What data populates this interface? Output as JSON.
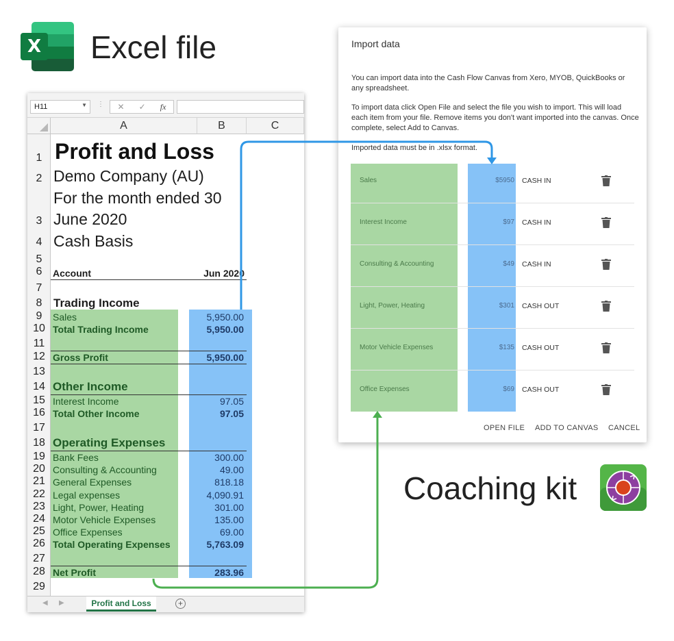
{
  "header": {
    "excel_logo_letter": "X",
    "title": "Excel file"
  },
  "excel": {
    "namebox": "H11",
    "formula_icons": [
      "✕",
      "✓",
      "fx"
    ],
    "columns": [
      "A",
      "B",
      "C"
    ],
    "rows": [
      {
        "n": "1"
      },
      {
        "n": "2"
      },
      {
        "n": "3"
      },
      {
        "n": "4"
      },
      {
        "n": "5"
      },
      {
        "n": "6"
      },
      {
        "n": "7"
      },
      {
        "n": "8"
      },
      {
        "n": "9"
      },
      {
        "n": "10"
      },
      {
        "n": "11"
      },
      {
        "n": "12"
      },
      {
        "n": "13"
      },
      {
        "n": "14"
      },
      {
        "n": "15"
      },
      {
        "n": "16"
      },
      {
        "n": "17"
      },
      {
        "n": "18"
      },
      {
        "n": "19"
      },
      {
        "n": "20"
      },
      {
        "n": "21"
      },
      {
        "n": "22"
      },
      {
        "n": "23"
      },
      {
        "n": "24"
      },
      {
        "n": "25"
      },
      {
        "n": "26"
      },
      {
        "n": "27"
      },
      {
        "n": "28"
      },
      {
        "n": "29"
      }
    ],
    "report_title": "Profit and Loss",
    "company": "Demo Company (AU)",
    "period_line1": "For the month ended 30",
    "period_line2": "June 2020",
    "basis": "Cash Basis",
    "account_header": "Account",
    "period_header": "Jun 2020",
    "trading_income": "Trading Income",
    "sales": {
      "label": "Sales",
      "value": "5,950.00"
    },
    "total_trading_income": {
      "label": "Total Trading Income",
      "value": "5,950.00"
    },
    "gross_profit": {
      "label": "Gross Profit",
      "value": "5,950.00"
    },
    "other_income": "Other Income",
    "interest_income": {
      "label": "Interest Income",
      "value": "97.05"
    },
    "total_other_income": {
      "label": "Total Other Income",
      "value": "97.05"
    },
    "operating_expenses": "Operating Expenses",
    "expenses": [
      {
        "label": "Bank Fees",
        "value": "300.00"
      },
      {
        "label": "Consulting & Accounting",
        "value": "49.00"
      },
      {
        "label": "General Expenses",
        "value": "818.18"
      },
      {
        "label": "Legal expenses",
        "value": "4,090.91"
      },
      {
        "label": "Light, Power, Heating",
        "value": "301.00"
      },
      {
        "label": "Motor Vehicle Expenses",
        "value": "135.00"
      },
      {
        "label": "Office Expenses",
        "value": "69.00"
      }
    ],
    "total_operating_expenses": {
      "label": "Total Operating Expenses",
      "value": "5,763.09"
    },
    "net_profit": {
      "label": "Net Profit",
      "value": "283.96"
    },
    "sheet_tab": "Profit and Loss",
    "add_sheet": "+"
  },
  "dialog": {
    "title": "Import data",
    "para1": "You can import data into the Cash Flow Canvas from Xero, MYOB, QuickBooks or any spreadsheet.",
    "para2": "To import data click Open File and select the file you wish to import. This will load each item from your file. Remove items you don't want imported into the canvas. Once complete, select Add to Canvas.",
    "para3": "Imported data must be in .xlsx format.",
    "items": [
      {
        "name": "Sales",
        "amount": "$5950",
        "type": "CASH IN"
      },
      {
        "name": "Interest Income",
        "amount": "$97",
        "type": "CASH IN"
      },
      {
        "name": "Consulting & Accounting",
        "amount": "$49",
        "type": "CASH IN"
      },
      {
        "name": "Light, Power, Heating",
        "amount": "$301",
        "type": "CASH OUT"
      },
      {
        "name": "Motor Vehicle Expenses",
        "amount": "$135",
        "type": "CASH OUT"
      },
      {
        "name": "Office Expenses",
        "amount": "$69",
        "type": "CASH OUT"
      }
    ],
    "buttons": {
      "open_file": "OPEN FILE",
      "add_to_canvas": "ADD TO CANVAS",
      "cancel": "CANCEL"
    }
  },
  "coaching": {
    "title": "Coaching kit"
  },
  "colors": {
    "green_highlight": "#a9d7a3",
    "blue_highlight": "#86c2f7",
    "blue_arrow": "#2f97e6",
    "green_arrow": "#4caf50",
    "excel_green": "#107c41"
  }
}
